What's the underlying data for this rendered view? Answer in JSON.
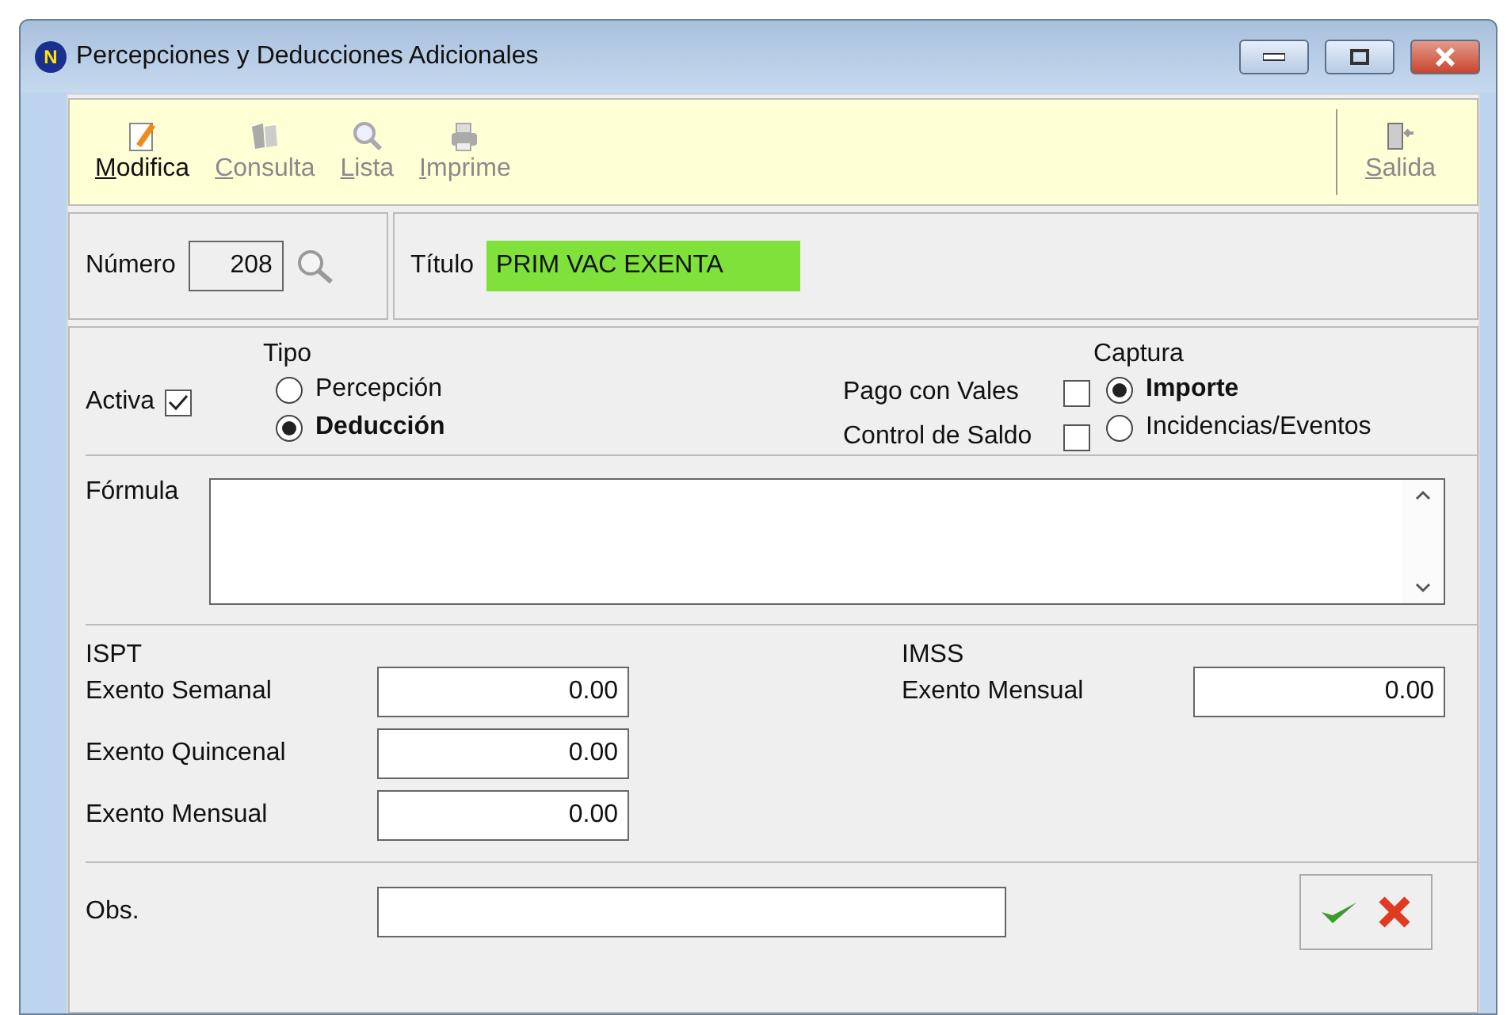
{
  "window": {
    "title": "Percepciones y Deducciones Adicionales",
    "app_badge": "N"
  },
  "toolbar": [
    {
      "label": "Modifica",
      "disabled": false,
      "kind": "edit"
    },
    {
      "label": "Consulta",
      "disabled": true,
      "kind": "book"
    },
    {
      "label": "Lista",
      "disabled": true,
      "kind": "search"
    },
    {
      "label": "Imprime",
      "disabled": true,
      "kind": "print"
    }
  ],
  "exit_button": {
    "label": "Salida",
    "disabled": true
  },
  "numero": {
    "label": "Número",
    "value": "208"
  },
  "titulo": {
    "label": "Título",
    "value": "PRIM VAC EXENTA"
  },
  "activa": {
    "label": "Activa",
    "checked": true
  },
  "tipo": {
    "label": "Tipo",
    "options": [
      {
        "label": "Percepción",
        "selected": false
      },
      {
        "label": "Deducción",
        "selected": true
      }
    ]
  },
  "flags": [
    {
      "label": "Pago con Vales",
      "checked": false
    },
    {
      "label": "Control de Saldo",
      "checked": false
    }
  ],
  "captura": {
    "label": "Captura",
    "options": [
      {
        "label": "Importe",
        "selected": true
      },
      {
        "label": "Incidencias/Eventos",
        "selected": false
      }
    ]
  },
  "formula": {
    "label": "Fórmula"
  },
  "ispt": {
    "label": "ISPT",
    "fields": [
      {
        "label": "Exento Semanal",
        "value": "0.00"
      },
      {
        "label": "Exento Quincenal",
        "value": "0.00"
      },
      {
        "label": "Exento Mensual",
        "value": "0.00"
      }
    ]
  },
  "imss": {
    "label": "IMSS",
    "fields": [
      {
        "label": "Exento Mensual",
        "value": "0.00"
      }
    ]
  },
  "obs": {
    "label": "Obs."
  }
}
